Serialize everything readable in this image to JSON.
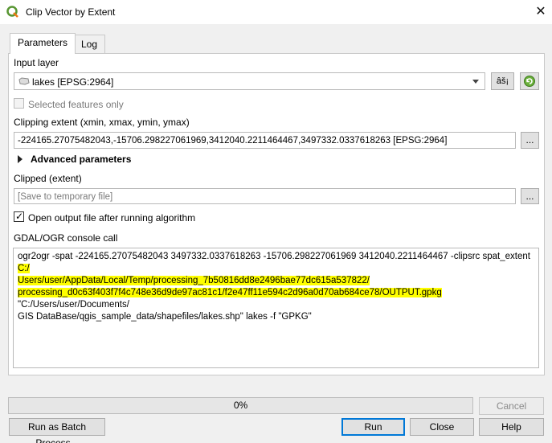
{
  "window": {
    "title": "Clip Vector by Extent",
    "close": "✕"
  },
  "tabs": [
    {
      "label": "Parameters"
    },
    {
      "label": "Log"
    }
  ],
  "input_layer": {
    "label": "Input layer",
    "value": "lakes [EPSG:2964]",
    "settings_label": "âš¡"
  },
  "selected_features": {
    "label": "Selected features only",
    "checked": false
  },
  "clipping_extent": {
    "label": "Clipping extent (xmin, xmax, ymin, ymax)",
    "value": "-224165.27075482043,-15706.298227061969,3412040.2211464467,3497332.0337618263 [EPSG:2964]",
    "browse": "..."
  },
  "advanced": {
    "label": "Advanced parameters"
  },
  "clipped": {
    "label": "Clipped (extent)",
    "placeholder": "[Save to temporary file]",
    "browse": "..."
  },
  "open_output": {
    "label": "Open output file after running algorithm",
    "checked": true,
    "mark": "✓"
  },
  "console": {
    "label": "GDAL/OGR console call",
    "line1_plain": "ogr2ogr -spat -224165.27075482043 3497332.0337618263 -15706.298227061969 3412040.2211464467 -clipsrc spat_extent ",
    "line1_hl": "C:/",
    "line2_hl": "Users/user/AppData/Local/Temp/processing_7b50816dd8e2496bae77dc615a537822/",
    "line3_hl": "processing_d0c63f403f7f4c748e36d9de97ac81c1/f2e47ff11e594c2d96a0d70ab684ce78/OUTPUT.gpkg",
    "line3_plain": " \"C:/Users/user/Documents/",
    "line4_plain": "GIS DataBase/qgis_sample_data/shapefiles/lakes.shp\" lakes -f \"GPKG\""
  },
  "progress": {
    "value": "0%",
    "fraction": 0
  },
  "buttons": {
    "cancel": "Cancel",
    "batch": "Run as Batch Process...",
    "run": "Run",
    "close": "Close",
    "help": "Help"
  }
}
